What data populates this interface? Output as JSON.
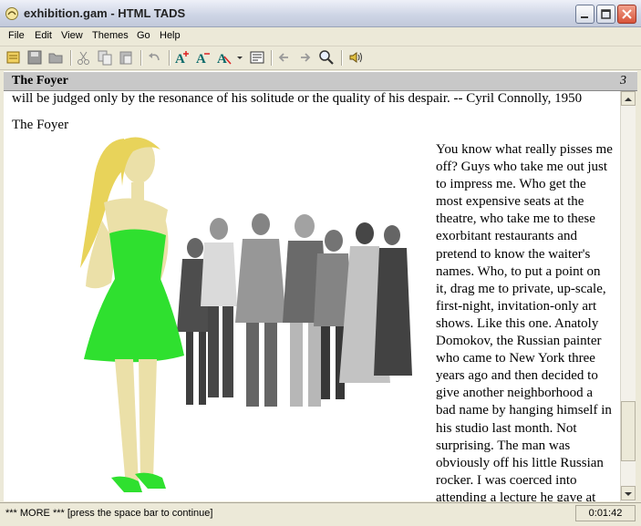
{
  "window": {
    "title": "exhibition.gam - HTML TADS"
  },
  "menubar": {
    "items": [
      "File",
      "Edit",
      "View",
      "Themes",
      "Go",
      "Help"
    ]
  },
  "toolbar": {
    "icons": [
      "open-icon",
      "save-icon",
      "folder-icon",
      "cut-icon",
      "copy-icon",
      "paste-icon",
      "undo-icon",
      "font-bigger-icon",
      "font-smaller-icon",
      "font-options-icon",
      "dropdown-icon",
      "page-setup-icon",
      "back-icon",
      "forward-icon",
      "search-icon",
      "speaker-icon"
    ]
  },
  "banner": {
    "location": "The Foyer",
    "score": "3"
  },
  "story": {
    "quote": "will be judged only by the resonance of his solitude or the quality of his despair.     -- Cyril Connolly, 1950",
    "room_title": "The Foyer",
    "paragraph": "You know what really pisses me off? Guys who take me out just to impress me. Who get the most expensive seats at the theatre, who take me to these exorbitant restaurants and pretend to know the waiter's names. Who, to put a point on it, drag me to private, up-scale, first-night, invitation-only art shows. Like this one. Anatoly Domokov, the Russian painter who came to New York three years ago and then decided to give another neighborhood a bad name by hanging himself in his studio last month. Not surprising. The man was obviously off his little Russian rocker. I was coerced into attending a lecture he gave at"
  },
  "status": {
    "prompt": "*** MORE *** [press the space bar to continue]",
    "timer": "0:01:42"
  },
  "colors": {
    "dress": "#2fe02f",
    "banner_bg": "#c8c8c8",
    "hair": "#e8d35a"
  }
}
